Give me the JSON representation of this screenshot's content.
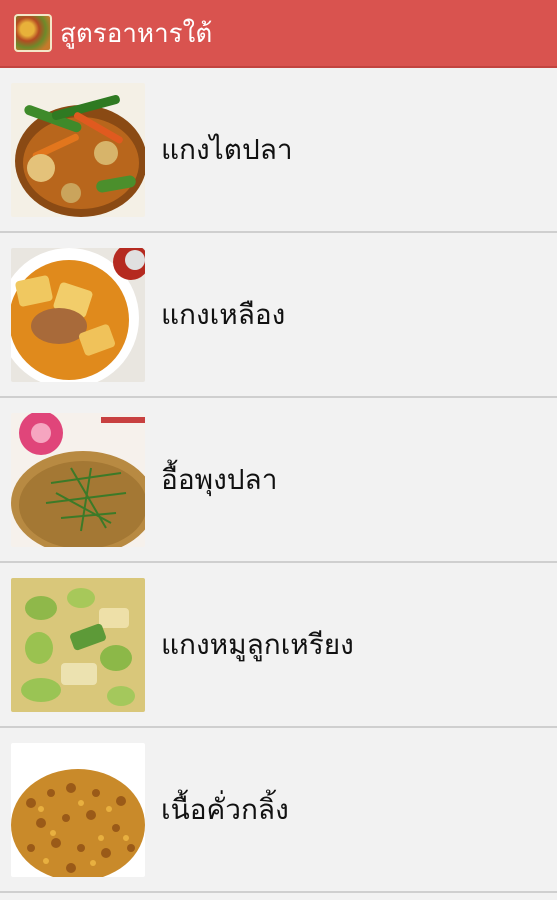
{
  "app": {
    "title": "สูตรอาหารใต้",
    "icon": "food-bowl-icon",
    "bar_color": "#d9534f"
  },
  "recipes": [
    {
      "name": "แกงไตปลา"
    },
    {
      "name": "แกงเหลือง"
    },
    {
      "name": "อื้อพุงปลา"
    },
    {
      "name": "แกงหมูลูกเหรียง"
    },
    {
      "name": "เนื้อคั่วกลิ้ง"
    }
  ]
}
